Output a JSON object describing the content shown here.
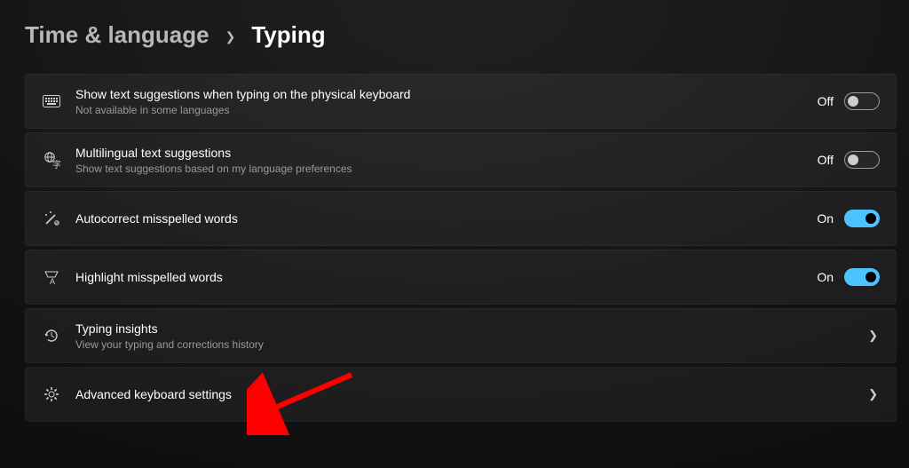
{
  "breadcrumb": {
    "parent": "Time & language",
    "current": "Typing"
  },
  "rows": {
    "physical": {
      "title": "Show text suggestions when typing on the physical keyboard",
      "subtitle": "Not available in some languages",
      "state": "Off"
    },
    "multilingual": {
      "title": "Multilingual text suggestions",
      "subtitle": "Show text suggestions based on my language preferences",
      "state": "Off"
    },
    "autocorrect": {
      "title": "Autocorrect misspelled words",
      "state": "On"
    },
    "highlight": {
      "title": "Highlight misspelled words",
      "state": "On"
    },
    "insights": {
      "title": "Typing insights",
      "subtitle": "View your typing and corrections history"
    },
    "advanced": {
      "title": "Advanced keyboard settings"
    }
  },
  "annotation": {
    "type": "arrow",
    "target": "advanced-keyboard-settings"
  }
}
